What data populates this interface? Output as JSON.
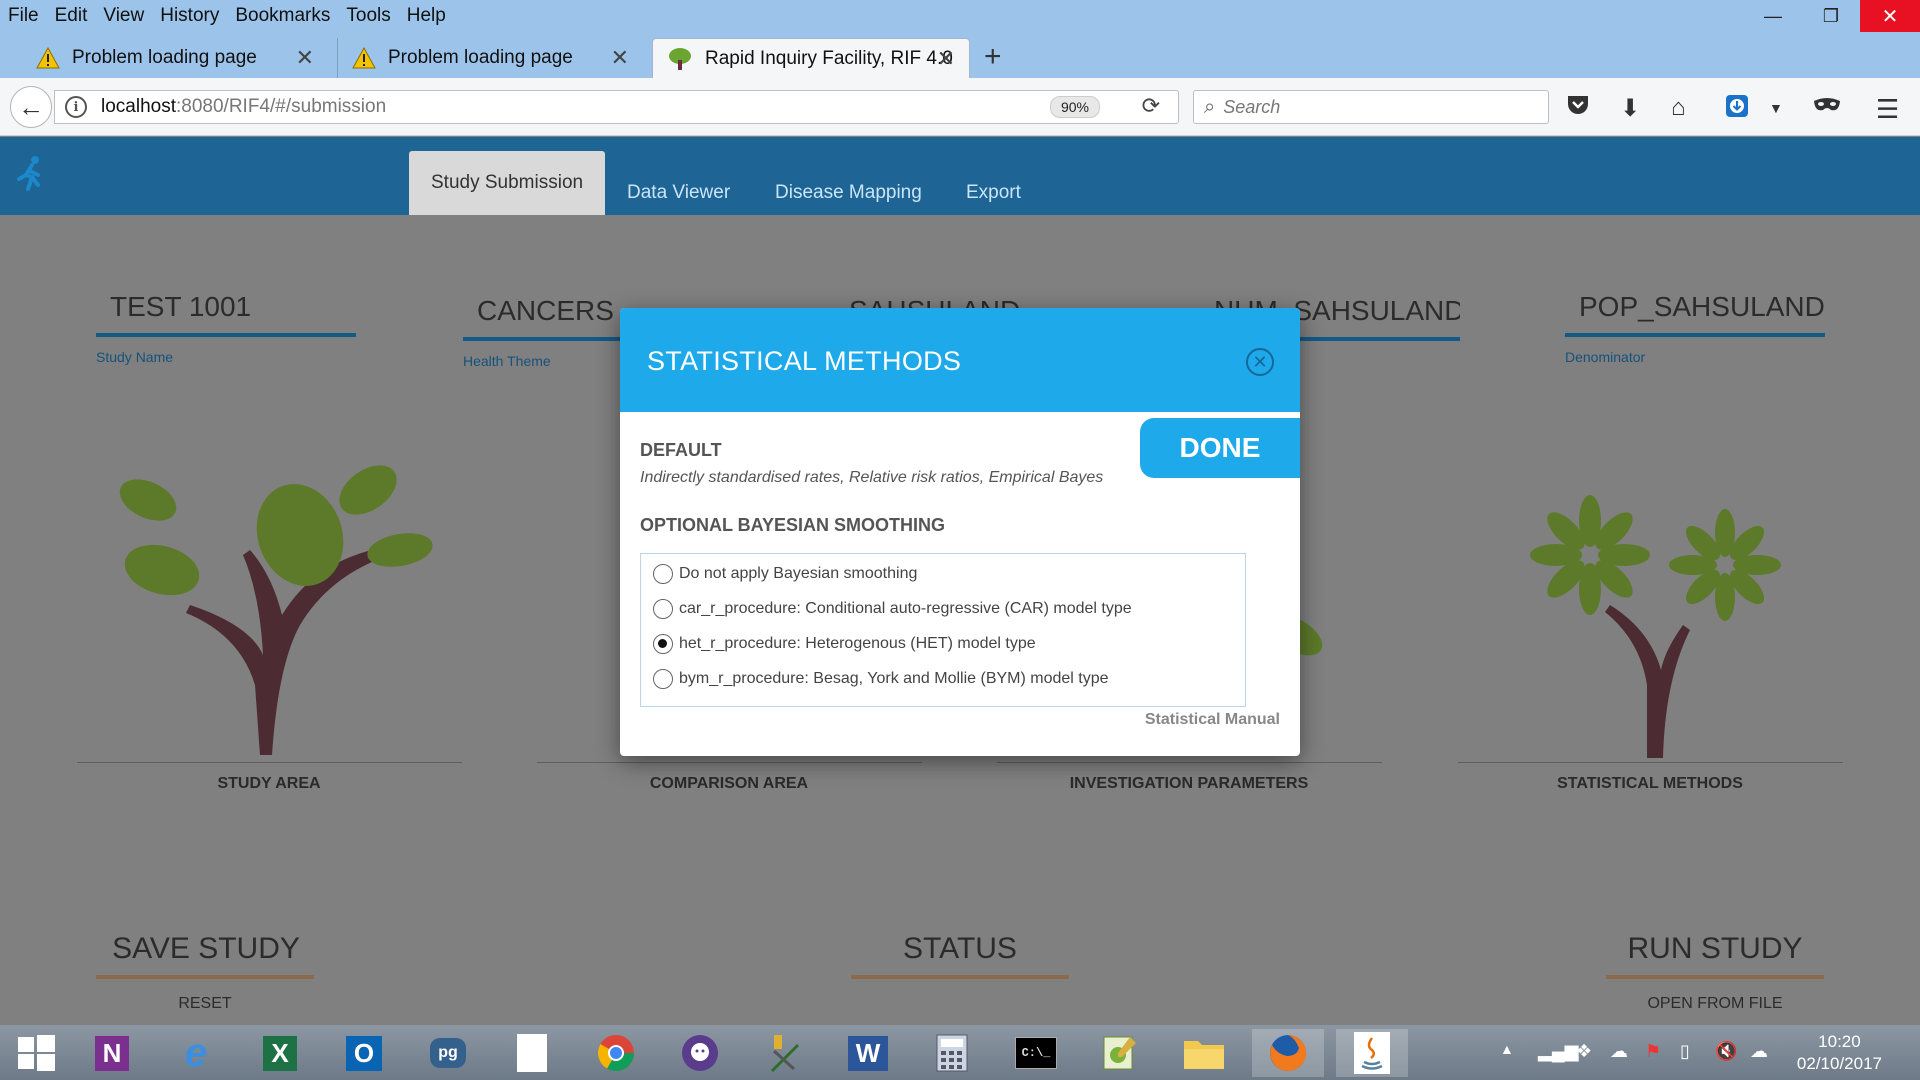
{
  "browser": {
    "menu": [
      "File",
      "Edit",
      "View",
      "History",
      "Bookmarks",
      "Tools",
      "Help"
    ],
    "window_controls": {
      "minimize": "—",
      "restore": "❐",
      "close": "✕"
    },
    "tabs": [
      {
        "label": "Problem loading page",
        "icon": "warning-icon"
      },
      {
        "label": "Problem loading page",
        "icon": "warning-icon"
      },
      {
        "label": "Rapid Inquiry Facility, RIF 4.0",
        "icon": "tree-icon"
      }
    ],
    "url_host": "localhost",
    "url_rest": ":8080/RIF4/#/submission",
    "zoom": "90%",
    "search_placeholder": "Search"
  },
  "app": {
    "tabs": [
      "Study Submission",
      "Data Viewer",
      "Disease Mapping",
      "Export"
    ],
    "active_tab": "Study Submission"
  },
  "fields": {
    "study_name": {
      "value": "TEST 1001",
      "label": "Study Name"
    },
    "health_theme": {
      "value": "CANCERS",
      "label": "Health Theme"
    },
    "numerator": {
      "value": "SAHSULAND"
    },
    "num_table": {
      "value": "NUM_SAHSULAND"
    },
    "denominator": {
      "value": "POP_SAHSULAND",
      "label": "Denominator"
    }
  },
  "cards": [
    "STUDY AREA",
    "COMPARISON AREA",
    "INVESTIGATION PARAMETERS",
    "STATISTICAL METHODS"
  ],
  "bottom": {
    "save": {
      "title": "SAVE STUDY",
      "link": "RESET"
    },
    "status": {
      "title": "STATUS"
    },
    "run": {
      "title": "RUN STUDY",
      "link": "OPEN FROM FILE"
    }
  },
  "modal": {
    "title": "STATISTICAL METHODS",
    "done": "DONE",
    "default_heading": "DEFAULT",
    "default_desc": "Indirectly standardised rates, Relative risk ratios, Empirical Bayes",
    "optional_heading": "OPTIONAL BAYESIAN SMOOTHING",
    "options": [
      {
        "label": "Do not apply Bayesian smoothing",
        "checked": false
      },
      {
        "label": "car_r_procedure: Conditional auto-regressive (CAR) model type",
        "checked": false
      },
      {
        "label": "het_r_procedure: Heterogenous (HET) model type",
        "checked": true
      },
      {
        "label": "bym_r_procedure: Besag, York and Mollie (BYM) model type",
        "checked": false
      }
    ],
    "manual_link": "Statistical Manual"
  },
  "taskbar": {
    "apps": [
      "N",
      "e",
      "X",
      "O",
      "pg",
      "",
      "chrome",
      "git",
      "",
      "W",
      "calc",
      "C:\\_",
      "",
      "files",
      "firefox",
      "java"
    ],
    "time": "10:20",
    "date": "02/10/2017"
  },
  "colors": {
    "header_blue": "#1e6494",
    "modal_blue": "#1ea9ea",
    "leaf_green": "#7aa33a",
    "trunk": "#6b2e3f"
  }
}
